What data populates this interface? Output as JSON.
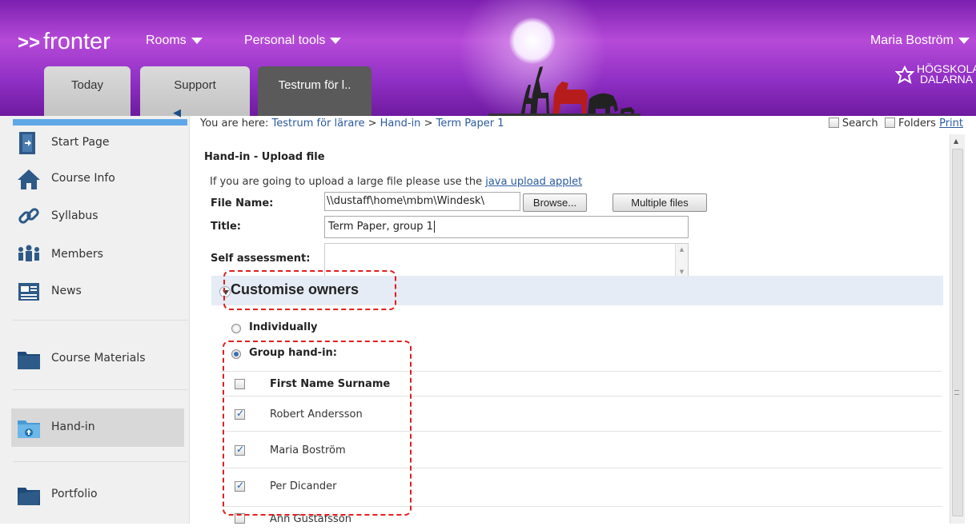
{
  "header": {
    "logo_arrows": ">>",
    "logo_text": "fronter",
    "menu_rooms": "Rooms",
    "menu_personal_tools": "Personal tools",
    "user_name": "Maria Boström",
    "institution_line1": "HÖGSKOLAN",
    "institution_line2": "DALARNA",
    "tabs": [
      {
        "label": "Today"
      },
      {
        "label": "Support"
      },
      {
        "label": "Testrum för l.."
      }
    ]
  },
  "sidebar": {
    "items": [
      {
        "label": "Start Page",
        "icon": "door-icon"
      },
      {
        "label": "Course Info",
        "icon": "house-icon"
      },
      {
        "label": "Syllabus",
        "icon": "chain-link-icon"
      },
      {
        "label": "Members",
        "icon": "people-icon"
      },
      {
        "label": "News",
        "icon": "newspaper-icon"
      },
      {
        "label": "Course Materials",
        "icon": "folder-icon"
      },
      {
        "label": "Hand-in",
        "icon": "folder-upload-icon"
      },
      {
        "label": "Portfolio",
        "icon": "portfolio-folder-icon"
      }
    ]
  },
  "breadcrumb": {
    "prefix": "You are here:",
    "items": [
      "Testrum för lärare",
      "Hand-in",
      "Term Paper 1"
    ],
    "separator": ">"
  },
  "top_right": {
    "search_label": "Search",
    "folders_label": "Folders",
    "print_label": "Print"
  },
  "form": {
    "section_title": "Hand-in - Upload file",
    "hint_text": "If you are going to upload a large file please use the",
    "hint_link": "java upload applet",
    "file_name_label": "File Name:",
    "file_name_value": "\\\\dustaff\\home\\mbm\\Windesk\\",
    "browse_label": "Browse...",
    "multiple_files_label": "Multiple files",
    "title_label": "Title:",
    "title_value": "Term Paper, group 1",
    "self_assessment_label": "Self assessment:",
    "customise_owners": "Customise owners",
    "individually_label": "Individually",
    "group_handin_label": "Group hand-in:",
    "name_header": "First Name Surname",
    "members": [
      {
        "name": "Robert Andersson",
        "checked": true
      },
      {
        "name": "Maria Boström",
        "checked": true
      },
      {
        "name": "Per Dicander",
        "checked": true
      },
      {
        "name": "Ann Gustafsson",
        "checked": false
      }
    ]
  },
  "colors": {
    "header_purple": "#9b3bcc",
    "link_blue": "#2a5aa0",
    "annotation_red": "#e01f1f"
  }
}
